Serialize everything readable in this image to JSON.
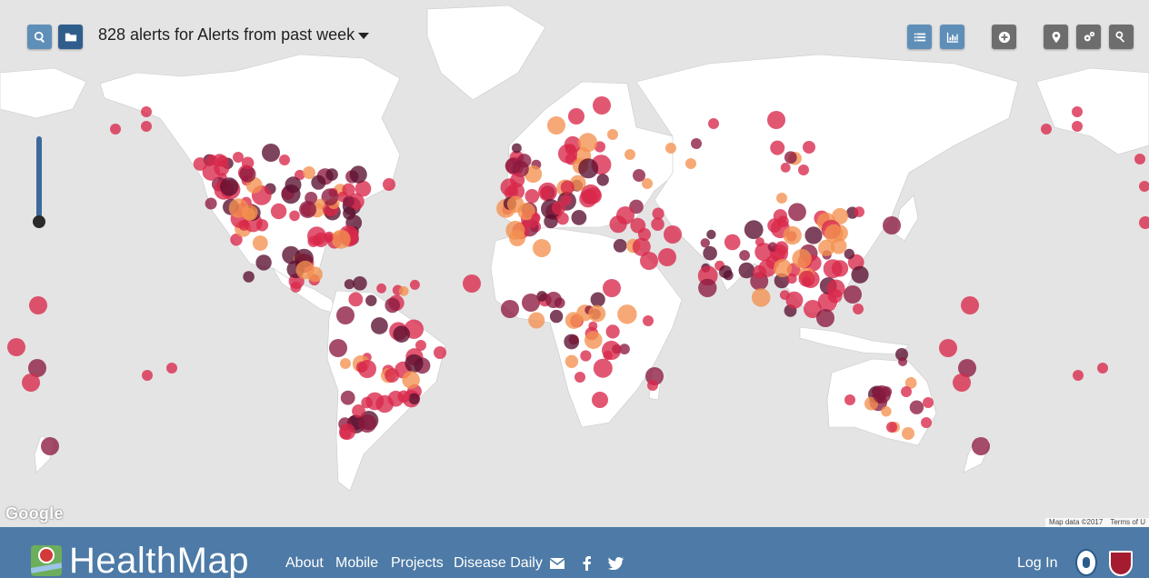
{
  "header": {
    "title": "828 alerts for Alerts from past week",
    "buttons": {
      "search": "search-icon",
      "folder": "folder-icon",
      "list": "list-icon",
      "chart": "bar-chart-icon",
      "add": "plus-icon",
      "location": "map-marker-icon",
      "settings": "gears-icon",
      "key": "key-icon"
    }
  },
  "map": {
    "google_label": "Google",
    "attribution": [
      "Map data ©2017",
      "Terms of U"
    ],
    "colors": {
      "light": "#f4914f",
      "medium": "#d8284a",
      "dark": "#8a1a3f",
      "darkest": "#5a1030"
    }
  },
  "footer": {
    "brand": "HealthMap",
    "nav": {
      "about": "About",
      "mobile": "Mobile",
      "projects": "Projects",
      "disease_daily": "Disease Daily"
    },
    "social": [
      "envelope-icon",
      "facebook-icon",
      "twitter-icon"
    ],
    "login": "Log In"
  }
}
